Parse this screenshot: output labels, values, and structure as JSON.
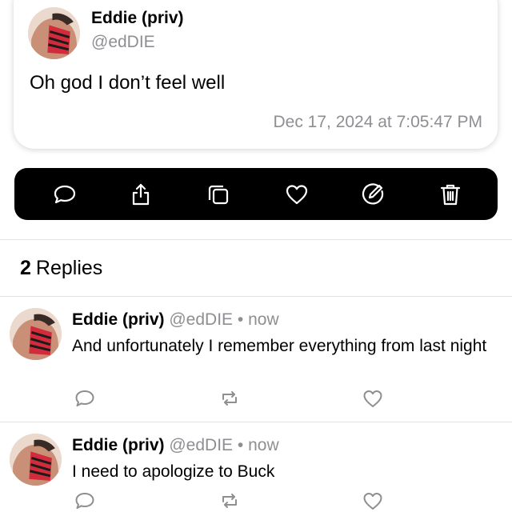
{
  "post": {
    "author_name": "Eddie (priv)",
    "author_handle": "@edDIE",
    "text": "Oh god I don’t feel well",
    "timestamp": "Dec 17, 2024 at 7:05:47 PM"
  },
  "actions": {
    "icons": [
      "comment-icon",
      "share-icon",
      "copy-icon",
      "heart-icon",
      "edit-icon",
      "trash-icon"
    ]
  },
  "replies_section": {
    "count": "2",
    "label": "Replies"
  },
  "replies": [
    {
      "name": "Eddie (priv)",
      "handle": "@edDIE",
      "separator": "•",
      "time": "now",
      "text": "And unfortunately I remember everything from last night"
    },
    {
      "name": "Eddie (priv)",
      "handle": "@edDIE",
      "separator": "•",
      "time": "now",
      "text": "I need to apologize to Buck"
    }
  ],
  "colors": {
    "secondary_text": "#8e8e93",
    "action_bar_bg": "#000000",
    "icon_gray": "#8e8e93"
  }
}
